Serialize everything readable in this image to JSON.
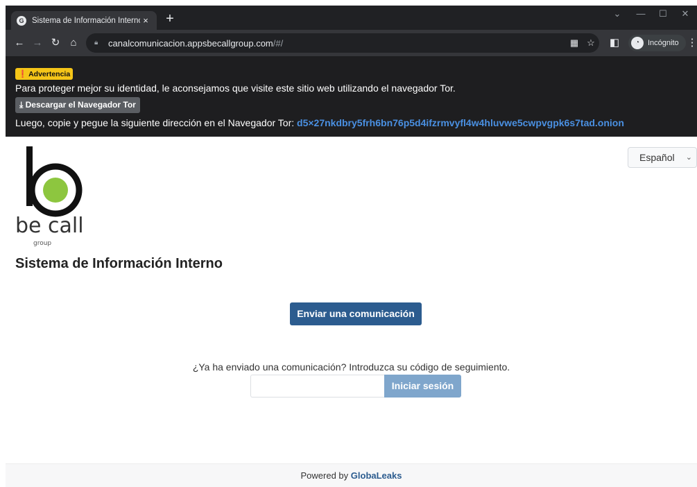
{
  "browser": {
    "tab_title": "Sistema de Información Interno",
    "tab_close": "×",
    "new_tab": "+",
    "url_host": "canalcomunicacion.appsbecallgroup.com",
    "url_path": "/#/",
    "profile_label": "Incógnito"
  },
  "banner": {
    "badge": "Advertencia",
    "message": "Para proteger mejor su identidad, le aconsejamos que visite este sitio web utilizando el navegador Tor.",
    "download_label": "Descargar el Navegador Tor",
    "copy_prefix": "Luego, copie y pegue la siguiente dirección en el Navegador Tor: ",
    "onion_address": "d5×27nkdbry5frh6bn76p5d4ifzrmvyfl4w4hluvwe5cwpvgpk6s7tad.onion"
  },
  "language": {
    "selected": "Español"
  },
  "logo": {
    "wordmark": "be call",
    "sub": "group",
    "accent_color": "#8dc63f"
  },
  "page": {
    "title": "Sistema de Información Interno",
    "send_button": "Enviar una comunicación",
    "tracking_prompt": "¿Ya ha enviado una comunicación? Introduzca su código de seguimiento.",
    "tracking_value": "",
    "login_button": "Iniciar sesión"
  },
  "footer": {
    "prefix": "Powered by ",
    "brand": "GlobaLeaks"
  },
  "colors": {
    "primary": "#2c5c8f",
    "primary_disabled": "#7fa6cc",
    "warning": "#f5c518",
    "onion_link": "#4a90e2"
  }
}
